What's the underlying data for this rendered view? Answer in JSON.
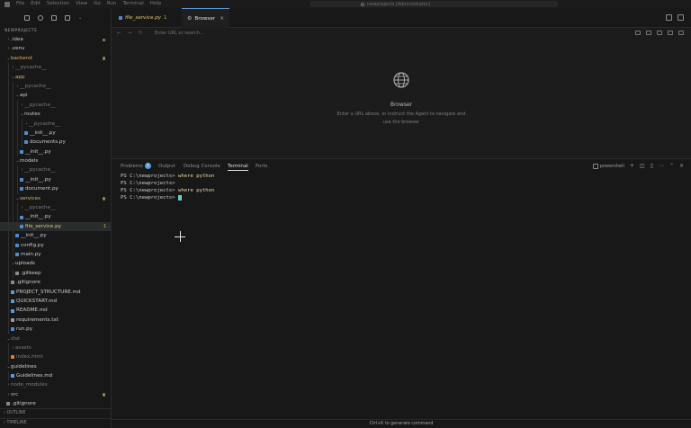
{
  "menu": [
    "File",
    "Edit",
    "Selection",
    "View",
    "Go",
    "Run",
    "Terminal",
    "Help"
  ],
  "command_search": "newprojects [Administrator]",
  "explorer": {
    "title": "NEWPROJECTS",
    "items": [
      {
        "label": ".idea",
        "depth": 0,
        "chev": "›",
        "color": "norm",
        "dot": true
      },
      {
        "label": ".venv",
        "depth": 0,
        "chev": "›",
        "color": "norm"
      },
      {
        "label": "backend",
        "depth": 0,
        "chev": "⌄",
        "color": "mod",
        "dot": true
      },
      {
        "label": "__pycache__",
        "depth": 1,
        "chev": "›",
        "color": "dim"
      },
      {
        "label": "app",
        "depth": 1,
        "chev": "⌄",
        "color": "mod"
      },
      {
        "label": "__pycache__",
        "depth": 2,
        "chev": "›",
        "color": "dim"
      },
      {
        "label": "api",
        "depth": 2,
        "chev": "⌄",
        "color": "norm"
      },
      {
        "label": "__pycache__",
        "depth": 3,
        "chev": "›",
        "color": "dim"
      },
      {
        "label": "routes",
        "depth": 3,
        "chev": "⌄",
        "color": "norm"
      },
      {
        "label": "__pycache__",
        "depth": 4,
        "chev": "›",
        "color": "dim"
      },
      {
        "label": "__init__.py",
        "depth": 4,
        "file": true,
        "color": "norm"
      },
      {
        "label": "documents.py",
        "depth": 4,
        "file": true,
        "color": "norm"
      },
      {
        "label": "__init__.py",
        "depth": 3,
        "file": true,
        "color": "norm"
      },
      {
        "label": "models",
        "depth": 2,
        "chev": "⌄",
        "color": "norm"
      },
      {
        "label": "__pycache__",
        "depth": 3,
        "chev": "›",
        "color": "dim"
      },
      {
        "label": "__init__.py",
        "depth": 3,
        "file": true,
        "color": "norm"
      },
      {
        "label": "document.py",
        "depth": 3,
        "file": true,
        "color": "norm"
      },
      {
        "label": "services",
        "depth": 2,
        "chev": "⌄",
        "color": "mod",
        "dot": true
      },
      {
        "label": "__pycache__",
        "depth": 3,
        "chev": "›",
        "color": "dim"
      },
      {
        "label": "__init__.py",
        "depth": 3,
        "file": true,
        "color": "norm"
      },
      {
        "label": "file_service.py",
        "depth": 3,
        "file": true,
        "color": "err",
        "badge": "1",
        "active": true
      },
      {
        "label": "__init__.py",
        "depth": 2,
        "file": true,
        "color": "norm"
      },
      {
        "label": "config.py",
        "depth": 2,
        "file": true,
        "color": "norm"
      },
      {
        "label": "main.py",
        "depth": 2,
        "file": true,
        "color": "norm"
      },
      {
        "label": "uploads",
        "depth": 1,
        "chev": "⌄",
        "color": "norm"
      },
      {
        "label": ".gitkeep",
        "depth": 2,
        "file": true,
        "color": "norm"
      },
      {
        "label": ".gitignore",
        "depth": 1,
        "file": true,
        "color": "norm"
      },
      {
        "label": "PROJECT_STRUCTURE.md",
        "depth": 1,
        "file": true,
        "color": "norm"
      },
      {
        "label": "QUICKSTART.md",
        "depth": 1,
        "file": true,
        "color": "norm"
      },
      {
        "label": "README.md",
        "depth": 1,
        "file": true,
        "color": "norm"
      },
      {
        "label": "requirements.txt",
        "depth": 1,
        "file": true,
        "color": "norm"
      },
      {
        "label": "run.py",
        "depth": 1,
        "file": true,
        "color": "norm"
      },
      {
        "label": "dist",
        "depth": 0,
        "chev": "⌄",
        "color": "dim"
      },
      {
        "label": "assets",
        "depth": 1,
        "chev": "›",
        "color": "dim"
      },
      {
        "label": "index.html",
        "depth": 1,
        "file": true,
        "color": "dim"
      },
      {
        "label": "guidelines",
        "depth": 0,
        "chev": "⌄",
        "color": "norm"
      },
      {
        "label": "Guidelines.md",
        "depth": 1,
        "file": true,
        "color": "norm"
      },
      {
        "label": "node_modules",
        "depth": 0,
        "chev": "›",
        "color": "dim"
      },
      {
        "label": "src",
        "depth": 0,
        "chev": "›",
        "color": "mod",
        "dot": true
      },
      {
        "label": ".gitignore",
        "depth": 0,
        "file": true,
        "color": "norm"
      }
    ],
    "outline_label": "OUTLINE",
    "timeline_label": "TIMELINE"
  },
  "tabs": {
    "file_tab": "file_service.py",
    "file_tab_badge": "1",
    "browser_tab": "Browser"
  },
  "browser": {
    "url_placeholder": "Enter URL or search...",
    "title": "Browser",
    "description": "Enter a URL above, or instruct the Agent to navigate and use the browser"
  },
  "panel": {
    "tabs": [
      "Problems",
      "Output",
      "Debug Console",
      "Terminal",
      "Ports"
    ],
    "problems_count": "1",
    "active_tab": "Terminal",
    "shell_name": "powershell"
  },
  "terminal": {
    "prompt": "PS C:\\newprojects>",
    "lines": [
      "where python",
      "",
      "where python",
      ""
    ]
  },
  "statusbar": {
    "hint": "Ctrl+K to generate command"
  },
  "colors": {
    "accent": "#5a9bd5",
    "modified": "#d9b86a",
    "cursor": "#6cc7d5"
  }
}
